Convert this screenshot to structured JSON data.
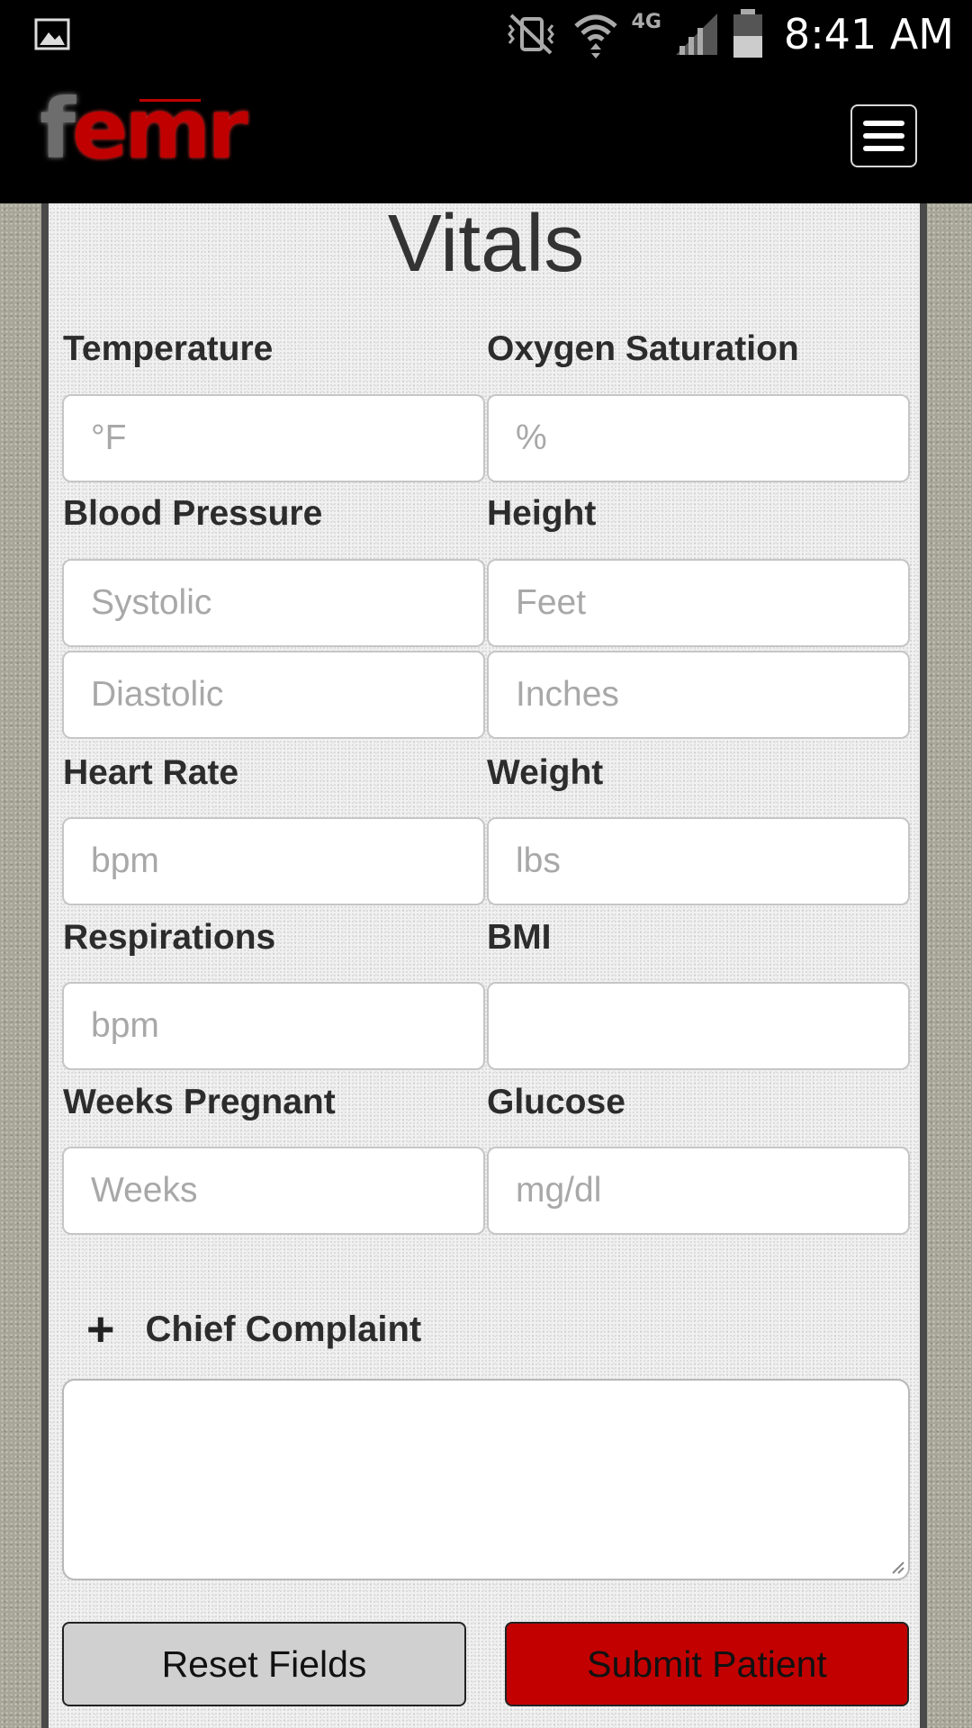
{
  "status_bar": {
    "network": "4G",
    "time": "8:41 AM"
  },
  "header": {
    "logo_first": "f",
    "logo_rest": "emr",
    "menu_icon": "hamburger-icon"
  },
  "page": {
    "title": "Vitals"
  },
  "fields": {
    "temperature": {
      "label": "Temperature",
      "placeholder": "°F"
    },
    "oxygen_saturation": {
      "label": "Oxygen Saturation",
      "placeholder": "%"
    },
    "blood_pressure": {
      "label": "Blood Pressure",
      "systolic_placeholder": "Systolic",
      "diastolic_placeholder": "Diastolic"
    },
    "height": {
      "label": "Height",
      "feet_placeholder": "Feet",
      "inches_placeholder": "Inches"
    },
    "heart_rate": {
      "label": "Heart Rate",
      "placeholder": "bpm"
    },
    "weight": {
      "label": "Weight",
      "placeholder": "lbs"
    },
    "respirations": {
      "label": "Respirations",
      "placeholder": "bpm"
    },
    "bmi": {
      "label": "BMI",
      "placeholder": ""
    },
    "weeks_pregnant": {
      "label": "Weeks Pregnant",
      "placeholder": "Weeks"
    },
    "glucose": {
      "label": "Glucose",
      "placeholder": "mg/dl"
    }
  },
  "chief_complaint": {
    "toggle_symbol": "+",
    "label": "Chief Complaint",
    "value": ""
  },
  "actions": {
    "reset_label": "Reset Fields",
    "submit_label": "Submit Patient"
  },
  "colors": {
    "brand_red": "#c20000",
    "reset_gray": "#d0d0d0"
  }
}
